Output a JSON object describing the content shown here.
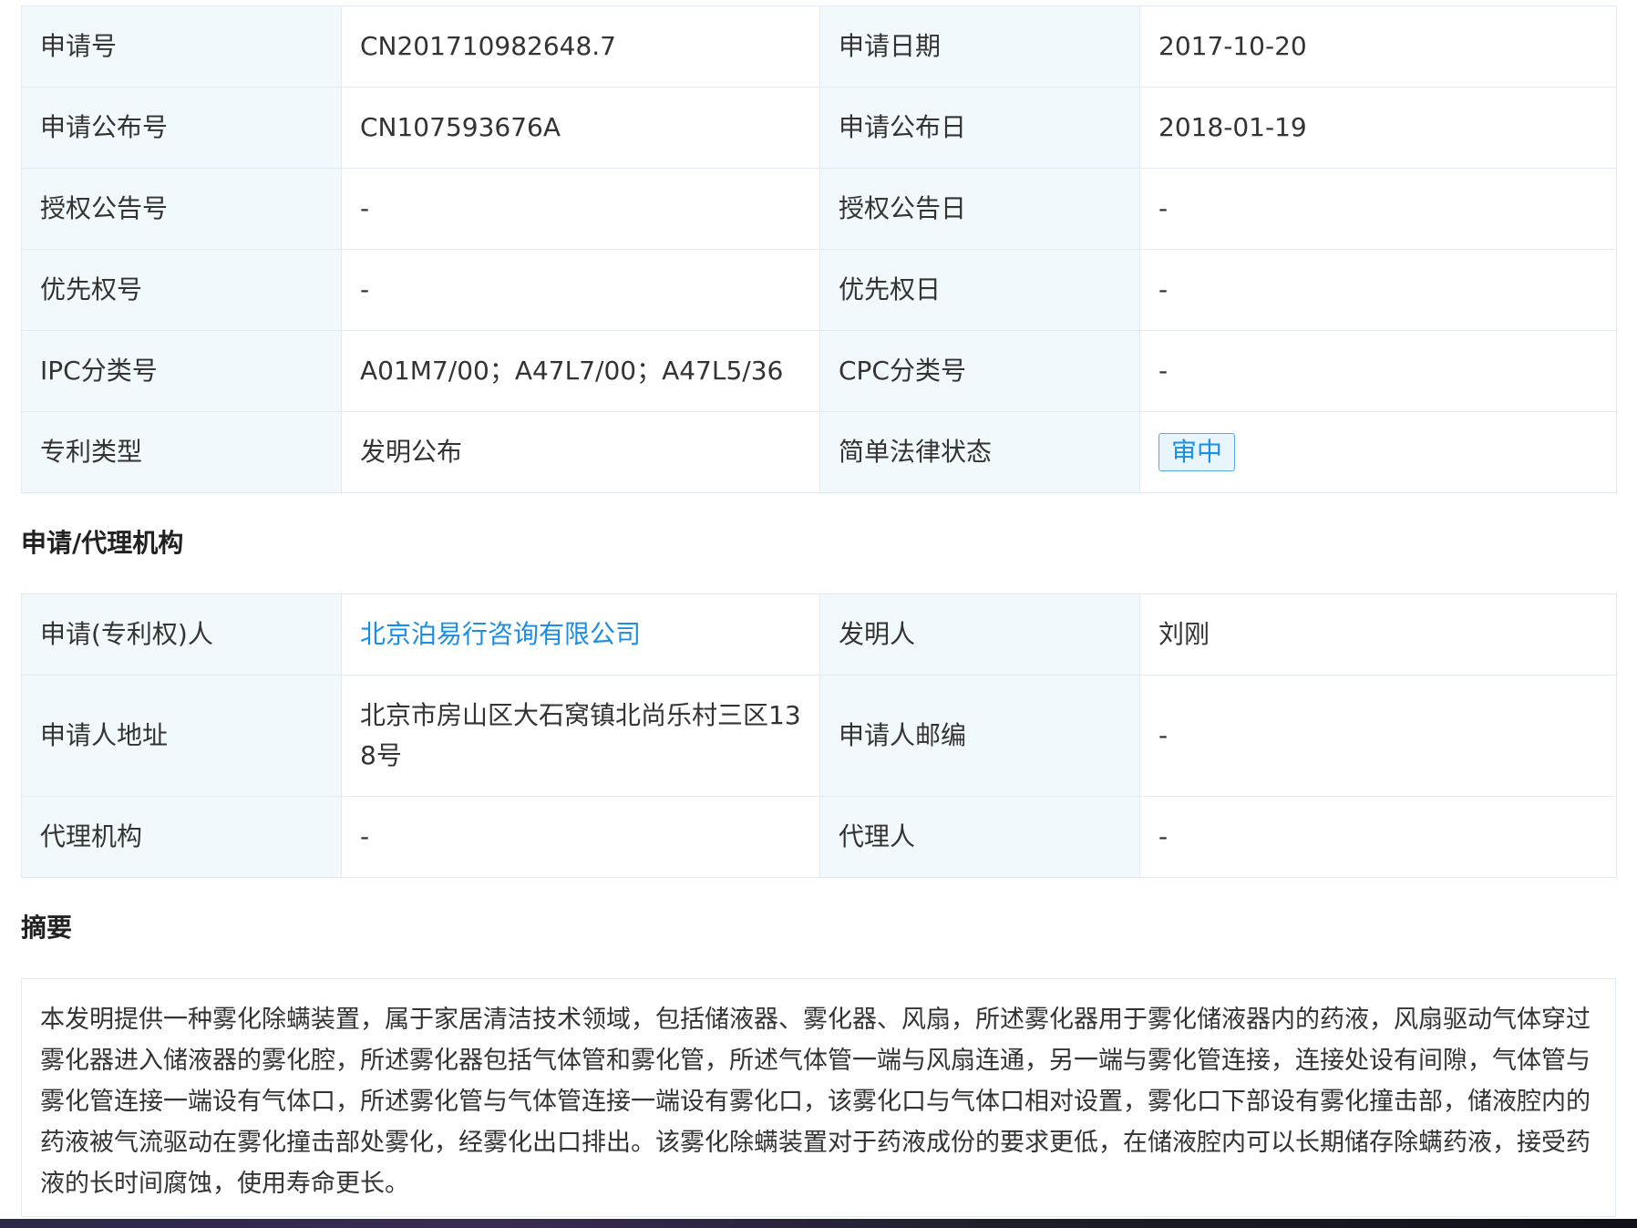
{
  "basic_info": {
    "rows": [
      {
        "l1": "申请号",
        "v1": "CN201710982648.7",
        "l2": "申请日期",
        "v2": "2017-10-20"
      },
      {
        "l1": "申请公布号",
        "v1": "CN107593676A",
        "l2": "申请公布日",
        "v2": "2018-01-19"
      },
      {
        "l1": "授权公告号",
        "v1": "-",
        "l2": "授权公告日",
        "v2": "-"
      },
      {
        "l1": "优先权号",
        "v1": "-",
        "l2": "优先权日",
        "v2": "-"
      },
      {
        "l1": "IPC分类号",
        "v1": "A01M7/00；A47L7/00；A47L5/36",
        "l2": "CPC分类号",
        "v2": "-"
      },
      {
        "l1": "专利类型",
        "v1": "发明公布",
        "l2": "简单法律状态",
        "v2": "审中"
      }
    ]
  },
  "agency_section": {
    "title": "申请/代理机构",
    "rows": [
      {
        "l1": "申请(专利权)人",
        "v1": "北京泊易行咨询有限公司",
        "l2": "发明人",
        "v2": "刘刚"
      },
      {
        "l1": "申请人地址",
        "v1": "北京市房山区大石窝镇北尚乐村三区138号",
        "l2": "申请人邮编",
        "v2": "-"
      },
      {
        "l1": "代理机构",
        "v1": "-",
        "l2": "代理人",
        "v2": "-"
      }
    ]
  },
  "abstract_section": {
    "title": "摘要",
    "text": "本发明提供一种雾化除螨装置，属于家居清洁技术领域，包括储液器、雾化器、风扇，所述雾化器用于雾化储液器内的药液，风扇驱动气体穿过雾化器进入储液器的雾化腔，所述雾化器包括气体管和雾化管，所述气体管一端与风扇连通，另一端与雾化管连接，连接处设有间隙，气体管与雾化管连接一端设有气体口，所述雾化管与气体管连接一端设有雾化口，该雾化口与气体口相对设置，雾化口下部设有雾化撞击部，储液腔内的药液被气流驱动在雾化撞击部处雾化，经雾化出口排出。该雾化除螨装置对于药液成份的要求更低，在储液腔内可以长期储存除螨药液，接受药液的长时间腐蚀，使用寿命更长。"
  },
  "colors": {
    "label_bg": "#f2f9fc",
    "border": "#e3eaf2",
    "link": "#1a8ee6",
    "text": "#333333"
  }
}
